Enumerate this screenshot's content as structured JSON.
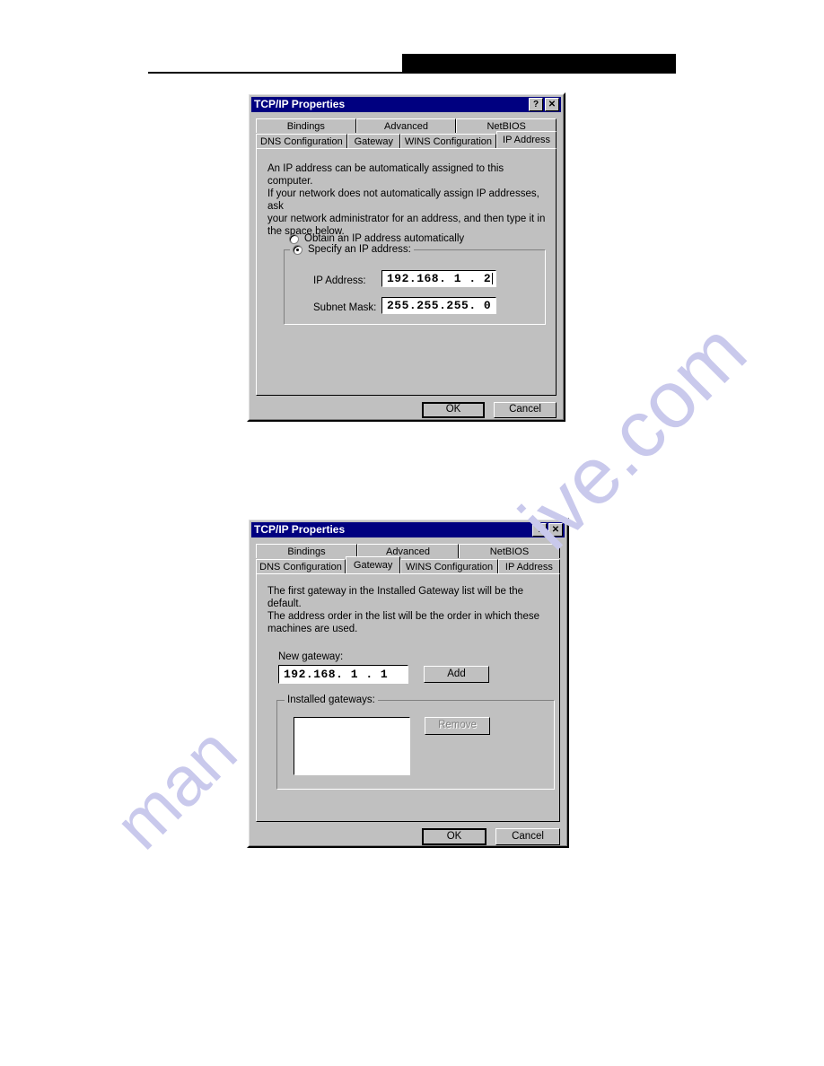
{
  "page": {
    "header": {
      "redaction_bar": "",
      "rule": ""
    },
    "watermark_right": "ive.com",
    "watermark_left": "man"
  },
  "dialogs": [
    {
      "id": "ip-address",
      "title": "TCP/IP Properties",
      "titlebar_buttons": [
        {
          "name": "help-button",
          "glyph": "?"
        },
        {
          "name": "close-button",
          "glyph": "✕"
        }
      ],
      "tabs_row1": [
        {
          "label": "Bindings",
          "active": false
        },
        {
          "label": "Advanced",
          "active": false
        },
        {
          "label": "NetBIOS",
          "active": false
        }
      ],
      "tabs_row2": [
        {
          "label": "DNS Configuration",
          "active": false
        },
        {
          "label": "Gateway",
          "active": false
        },
        {
          "label": "WINS Configuration",
          "active": false
        },
        {
          "label": "IP Address",
          "active": true
        }
      ],
      "description": "An IP address can be automatically assigned to this computer.\nIf your network does not automatically assign IP addresses, ask\nyour network administrator for an address, and then type it in\nthe space below.",
      "radio_obtain": {
        "label": "Obtain an IP address automatically",
        "checked": false
      },
      "radio_specify": {
        "label": "Specify an IP address:",
        "checked": true
      },
      "fields": [
        {
          "label": "IP Address:",
          "value": "192.168. 1 . 2",
          "has_caret": true
        },
        {
          "label": "Subnet Mask:",
          "value": "255.255.255. 0",
          "has_caret": false
        }
      ],
      "buttons": {
        "ok": "OK",
        "cancel": "Cancel"
      }
    },
    {
      "id": "gateway",
      "title": "TCP/IP Properties",
      "titlebar_buttons": [
        {
          "name": "help-button",
          "glyph": "?"
        },
        {
          "name": "close-button",
          "glyph": "✕"
        }
      ],
      "tabs_row1": [
        {
          "label": "Bindings",
          "active": false
        },
        {
          "label": "Advanced",
          "active": false
        },
        {
          "label": "NetBIOS",
          "active": false
        }
      ],
      "tabs_row2": [
        {
          "label": "DNS Configuration",
          "active": false
        },
        {
          "label": "Gateway",
          "active": true
        },
        {
          "label": "WINS Configuration",
          "active": false
        },
        {
          "label": "IP Address",
          "active": false
        }
      ],
      "description": "The first gateway in the Installed Gateway list will be the default.\nThe address order in the list will be the order in which these\nmachines are used.",
      "new_gateway_label": "New gateway:",
      "new_gateway_value": "192.168. 1 . 1",
      "add_button": "Add",
      "installed_group_legend": "Installed gateways:",
      "installed_list_items": [],
      "remove_button": "Remove",
      "buttons": {
        "ok": "OK",
        "cancel": "Cancel"
      }
    }
  ],
  "colors": {
    "titlebar": "#000080",
    "face": "#c0c0c0",
    "field": "#ffffff",
    "watermark": "#c9c9ec"
  }
}
